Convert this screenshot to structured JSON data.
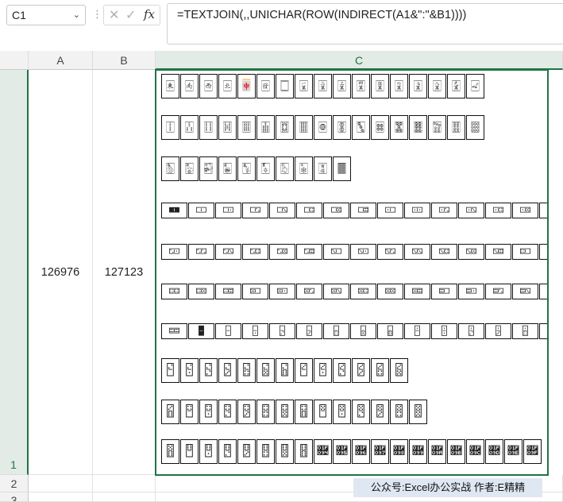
{
  "formula_bar": {
    "name_box": "C1",
    "formula": "=TEXTJOIN(,,UNICHAR(ROW(INDIRECT(A1&\":\"&B1))))"
  },
  "columns": [
    "A",
    "B",
    "C"
  ],
  "rows": [
    "1",
    "2",
    "3"
  ],
  "cells": {
    "A1": "126976",
    "B1": "127123"
  },
  "c1_rows": [
    "🀀🀁🀂🀃🀄🀅🀆🀇🀈🀉🀊🀋🀌🀍🀎🀏🀐",
    "🀑🀒🀓🀔🀕🀖🀗🀘🀙🀚🀛🀜🀝🀞🀟🀠🀡",
    "🀢🀣🀤🀥🀦🀧🀨🀩🀪🀫",
    "🀰🀱🀲🀳🀴🀵🀶🀷🀸🀹🀺🀻🀼🀽🀾🀿",
    "🁀🁁🁂🁃🁄🁅🁆🁇🁈🁉🁊🁋🁌🁍🁎🁏🁐",
    "🁑🁒🁓🁔🁕🁖🁗🁘🁙🁚🁛🁜🁝🁞🁟🁠",
    "🁡🁢🁣🁤🁥🁦🁧🁨🁩🁪🁫🁬🁭🁮🁯🁰",
    "🁱🁲🁳🁴🁵🁶🁷🁸🁹🁺🁻🁼🁽",
    "🁾🁿🂀🂁🂂🂃🂄🂅🂆🂇🂈🂉🂊🂋",
    "🂌🂍🂎🂏🂐🂑🂒🂓🂔🂕🂖🂗🂘🂙🂚🂛🂜🂝🂞🂟"
  ],
  "watermark": "公众号:Excel办公实战  作者:E精精"
}
